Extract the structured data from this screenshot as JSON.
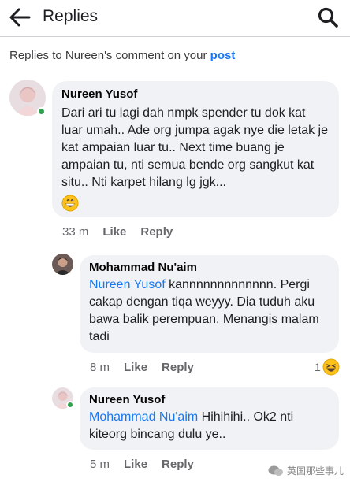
{
  "header": {
    "title": "Replies"
  },
  "context": {
    "prefix": "Replies to Nureen's comment on your",
    "link": "post"
  },
  "comments": [
    {
      "author": "Nureen Yusof",
      "text": "Dari ari tu lagi dah nmpk spender tu dok kat luar umah.. Ade org jumpa agak nye die letak je kat ampaian luar tu.. Next time buang je ampaian tu, nti semua bende org sangkut kat situ.. Nti karpet hilang lg jgk...",
      "time": "33 m",
      "like": "Like",
      "reply": "Reply"
    },
    {
      "author": "Mohammad Nu'aim",
      "mention": "Nureen Yusof",
      "text": " kannnnnnnnnnnnn. Pergi cakap dengan tiqa weyyy. Dia tuduh aku bawa balik perempuan. Menangis malam tadi",
      "time": "8 m",
      "like": "Like",
      "reply": "Reply",
      "reaction_count": "1"
    },
    {
      "author": "Nureen Yusof",
      "mention": "Mohammad Nu'aim",
      "text": " Hihihihi.. Ok2 nti kiteorg bincang dulu ye..",
      "time": "5 m",
      "like": "Like",
      "reply": "Reply"
    }
  ],
  "watermark": {
    "text": "英国那些事儿"
  },
  "icons": {
    "back": "arrow-left-icon",
    "search": "search-icon",
    "emoji": "grinning-face-icon",
    "reaction": "laughing-face-icon"
  },
  "colors": {
    "link": "#1877f2",
    "bubble": "#f0f2f5",
    "online": "#31a24c",
    "muted": "#65676b"
  }
}
